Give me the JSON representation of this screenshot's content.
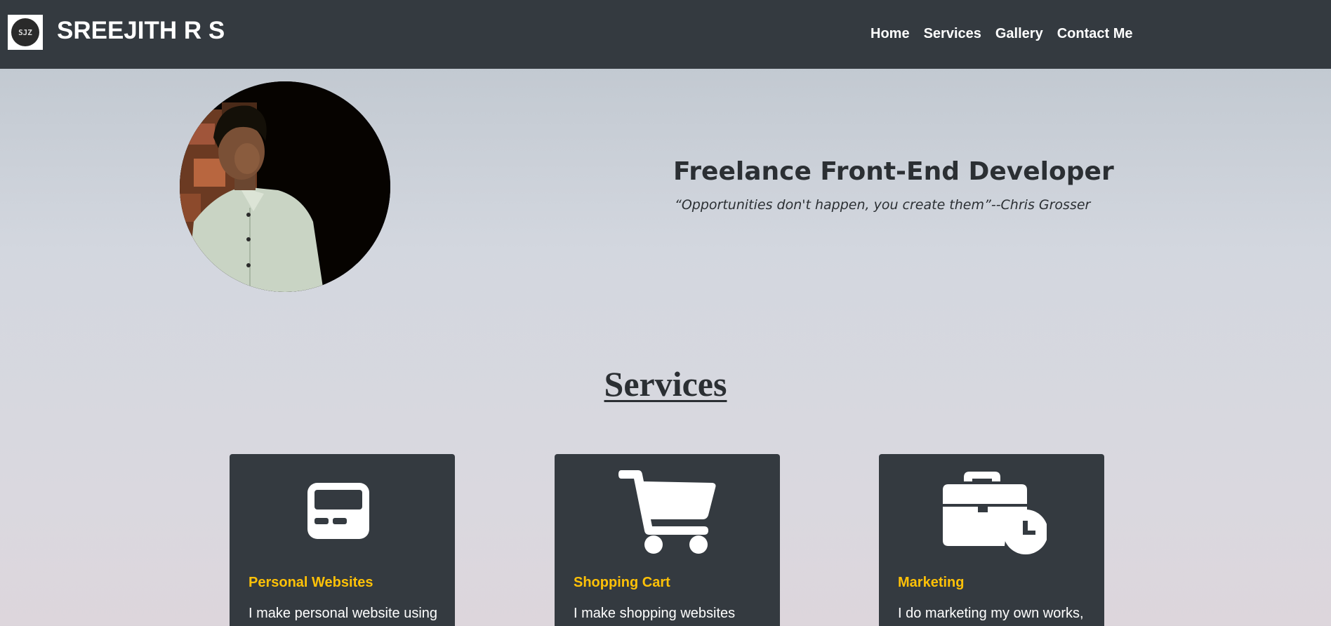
{
  "header": {
    "logo_text": "SJZ",
    "brand": "SREEJITH R S",
    "nav": [
      {
        "label": "Home"
      },
      {
        "label": "Services"
      },
      {
        "label": "Gallery"
      },
      {
        "label": "Contact Me"
      }
    ]
  },
  "hero": {
    "title": "Freelance Front-End Developer",
    "quote": "“Opportunities don't happen, you create them”--Chris Grosser"
  },
  "services": {
    "heading": "Services",
    "cards": [
      {
        "icon": "pager-icon",
        "title": "Personal Websites",
        "text": "I make personal website using"
      },
      {
        "icon": "shopping-cart-icon",
        "title": "Shopping Cart",
        "text": "I make shopping websites"
      },
      {
        "icon": "business-time-icon",
        "title": "Marketing",
        "text": "I do marketing my own works,"
      }
    ]
  },
  "colors": {
    "navbar_bg": "#343a40",
    "card_bg": "#343a40",
    "accent": "#ffc107",
    "text_dark": "#2b2f33"
  }
}
